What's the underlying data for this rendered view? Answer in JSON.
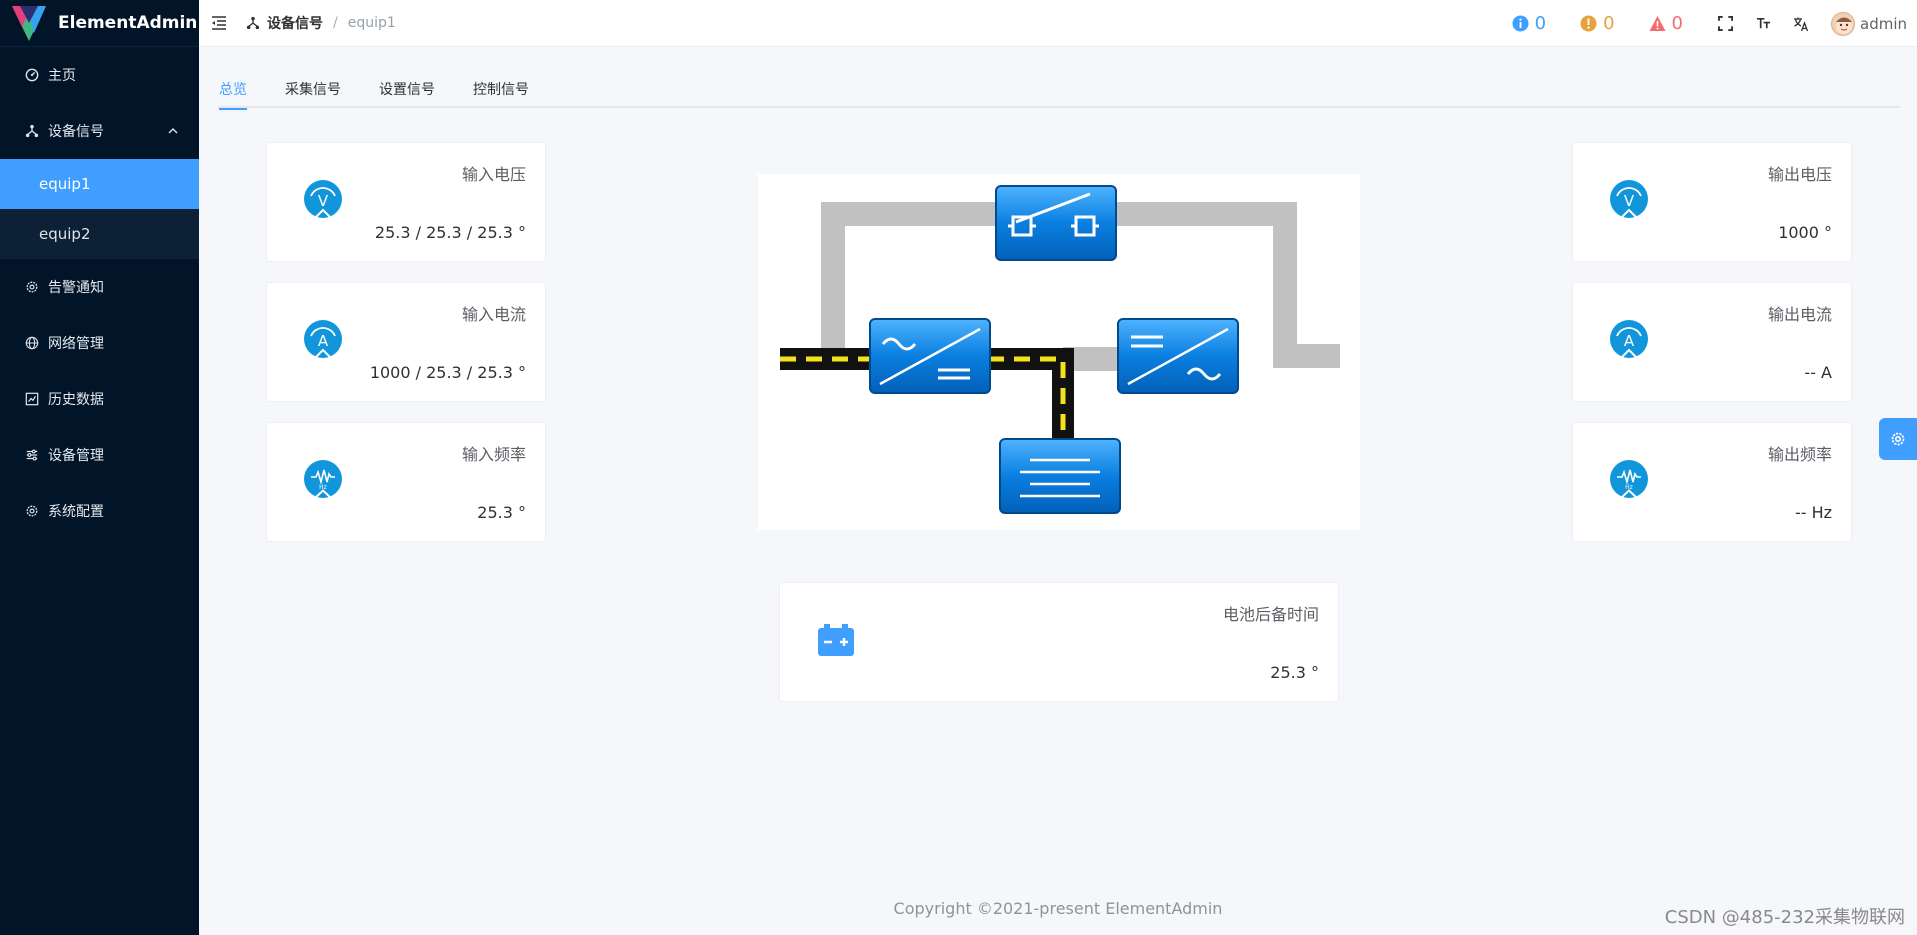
{
  "app": {
    "name": "ElementAdmin"
  },
  "sidebar": {
    "items": [
      {
        "label": "主页",
        "icon": "dashboard-icon"
      },
      {
        "label": "设备信号",
        "icon": "network-icon",
        "expanded": true,
        "children": [
          {
            "label": "equip1",
            "active": true
          },
          {
            "label": "equip2",
            "active": false
          }
        ]
      },
      {
        "label": "告警通知",
        "icon": "gear-icon"
      },
      {
        "label": "网络管理",
        "icon": "globe-icon"
      },
      {
        "label": "历史数据",
        "icon": "chart-icon"
      },
      {
        "label": "设备管理",
        "icon": "sliders-icon"
      },
      {
        "label": "系统配置",
        "icon": "gear-icon"
      }
    ]
  },
  "header": {
    "breadcrumb": {
      "parent": "设备信号",
      "separator": "/",
      "current": "equip1"
    },
    "badges": [
      {
        "type": "info",
        "count": "0",
        "color": "#409eff"
      },
      {
        "type": "warning",
        "count": "0",
        "color": "#e6a23c"
      },
      {
        "type": "error",
        "count": "0",
        "color": "#f56c6c"
      }
    ],
    "user": {
      "name": "admin"
    }
  },
  "tabs": [
    {
      "label": "总览",
      "active": true
    },
    {
      "label": "采集信号",
      "active": false
    },
    {
      "label": "设置信号",
      "active": false
    },
    {
      "label": "控制信号",
      "active": false
    }
  ],
  "cards": {
    "input_voltage": {
      "title": "输入电压",
      "value": "25.3 / 25.3 / 25.3 °"
    },
    "input_current": {
      "title": "输入电流",
      "value": "1000 / 25.3 / 25.3 °"
    },
    "input_frequency": {
      "title": "输入频率",
      "value": "25.3 °"
    },
    "output_voltage": {
      "title": "输出电压",
      "value": "1000 °"
    },
    "output_current": {
      "title": "输出电流",
      "value": "-- A"
    },
    "output_frequency": {
      "title": "输出频率",
      "value": "-- Hz"
    },
    "battery_backup": {
      "title": "电池后备时间",
      "value": "25.3 °"
    }
  },
  "footer": {
    "copyright": "Copyright ©2021-present ElementAdmin"
  },
  "watermark": "CSDN @485-232采集物联网",
  "colors": {
    "accent": "#409eff",
    "sidebar_bg": "#011428",
    "card_icon": "#1296db"
  }
}
